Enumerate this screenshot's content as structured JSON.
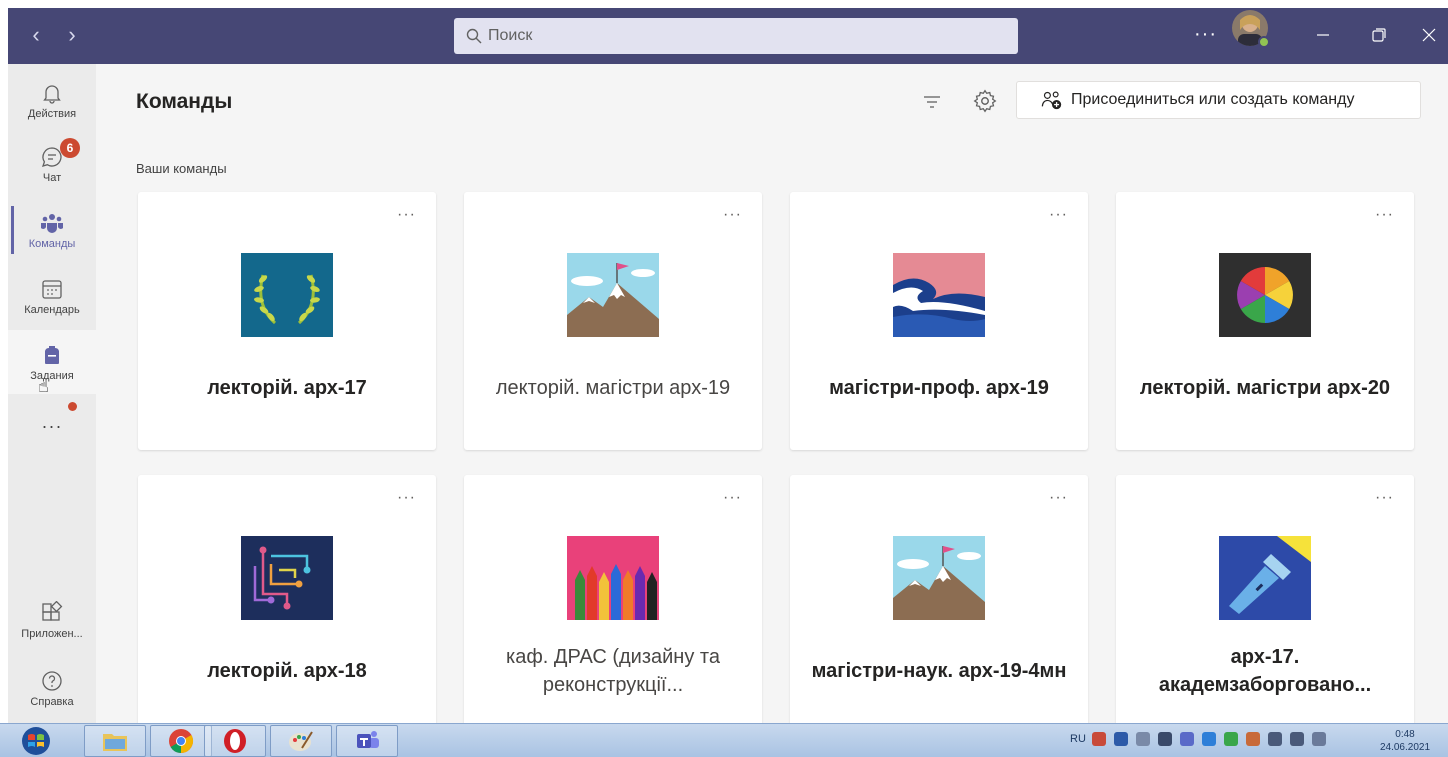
{
  "search": {
    "placeholder": "Поиск"
  },
  "titlebar": {
    "more": "···"
  },
  "rail": {
    "items": [
      {
        "label": "Действия",
        "icon": "bell-icon"
      },
      {
        "label": "Чат",
        "icon": "chat-icon",
        "badge": "6"
      },
      {
        "label": "Команды",
        "icon": "teams-icon",
        "active": true
      },
      {
        "label": "Календарь",
        "icon": "calendar-icon"
      },
      {
        "label": "Задания",
        "icon": "assignments-icon"
      },
      {
        "label": "Приложен...",
        "icon": "apps-icon"
      },
      {
        "label": "Справка",
        "icon": "help-icon"
      }
    ],
    "more": "···"
  },
  "main": {
    "title": "Команды",
    "join_label": "Присоединиться или создать команду",
    "section_label": "Ваши команды"
  },
  "teams": [
    {
      "name": "лекторій. арх-17",
      "bold": true,
      "image": "laurel-wreath"
    },
    {
      "name": "лекторій. магістри арх-19",
      "bold": false,
      "image": "mountain-flag"
    },
    {
      "name": "магістри-проф. арх-19",
      "bold": true,
      "image": "wave"
    },
    {
      "name": "лекторій. магістри арх-20",
      "bold": true,
      "image": "color-wheel"
    },
    {
      "name": "лекторій. арх-18",
      "bold": true,
      "image": "circuit"
    },
    {
      "name": "каф. ДРАС (дизайну та реконструкції...",
      "bold": false,
      "image": "pencils"
    },
    {
      "name": "магістри-наук. арх-19-4мн",
      "bold": true,
      "image": "mountain-flag"
    },
    {
      "name": "арх-17. академзаборговано...",
      "bold": true,
      "image": "flashlight"
    }
  ],
  "card_more": "···",
  "taskbar": {
    "lang": "RU",
    "time": "0:48",
    "date": "24.06.2021",
    "apps": [
      "explorer",
      "chrome",
      "opera",
      "paint",
      "teams"
    ]
  },
  "colors": {
    "titlebar": "#464775",
    "accent": "#6264a7",
    "badge": "#cc4a31"
  }
}
